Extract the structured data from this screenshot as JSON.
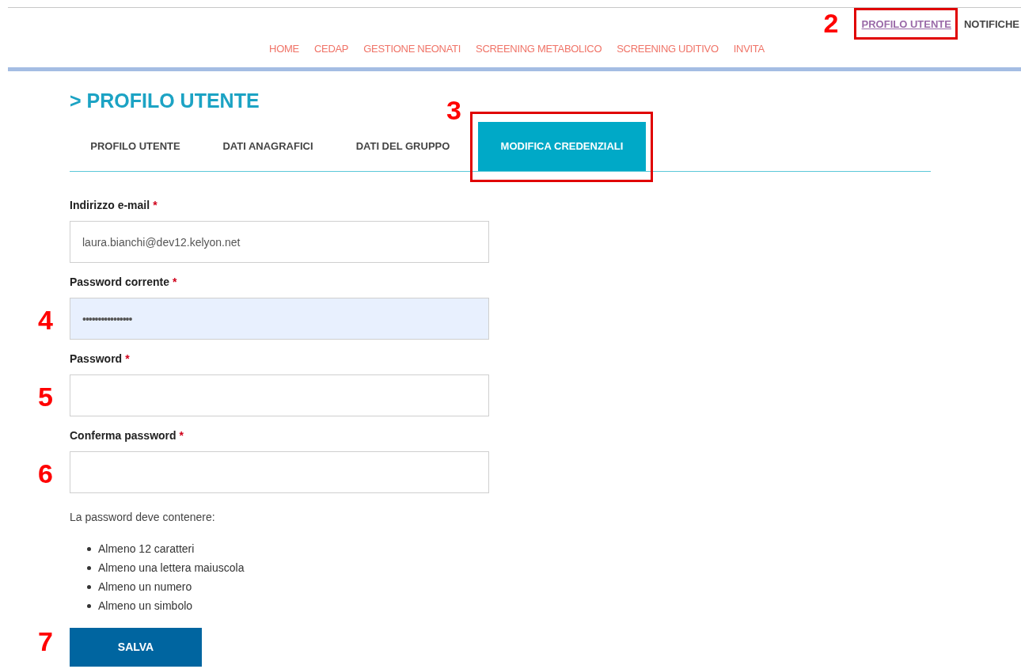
{
  "user_links": [
    {
      "label": "PROFILO UTENTE",
      "selected": true,
      "callout": "2",
      "framed": true
    },
    {
      "label": "NOTIFICHE",
      "selected": false
    }
  ],
  "nav": [
    "HOME",
    "CEDAP",
    "GESTIONE NEONATI",
    "SCREENING METABOLICO",
    "SCREENING UDITIVO",
    "INVITA"
  ],
  "page_title": "> PROFILO UTENTE",
  "tabs": [
    {
      "label": "PROFILO UTENTE",
      "selected": false
    },
    {
      "label": "DATI ANAGRAFICI",
      "selected": false
    },
    {
      "label": "DATI DEL GRUPPO",
      "selected": false
    },
    {
      "label": "MODIFICA CREDENZIALI",
      "selected": true,
      "callout": "3",
      "framed": true
    }
  ],
  "fields": [
    {
      "label": "Indirizzo e-mail",
      "required_mark": "*",
      "value": "laura.bianchi@dev12.kelyon.net",
      "autofilled": false
    },
    {
      "label": "Password corrente",
      "required_mark": "*",
      "value": "••••••••••••••••",
      "autofilled": true,
      "callout": "4"
    },
    {
      "label": "Password",
      "required_mark": "*",
      "autofilled": false,
      "callout": "5"
    },
    {
      "label": "Conferma password",
      "required_mark": "*",
      "autofilled": false,
      "callout": "6"
    }
  ],
  "hint": "La password deve contenere:",
  "rules": [
    "Almeno 12 caratteri",
    "Almeno una lettera maiuscola",
    "Almeno un numero",
    "Almeno un simbolo"
  ],
  "save_button": {
    "label": "SALVA",
    "callout": "7"
  }
}
